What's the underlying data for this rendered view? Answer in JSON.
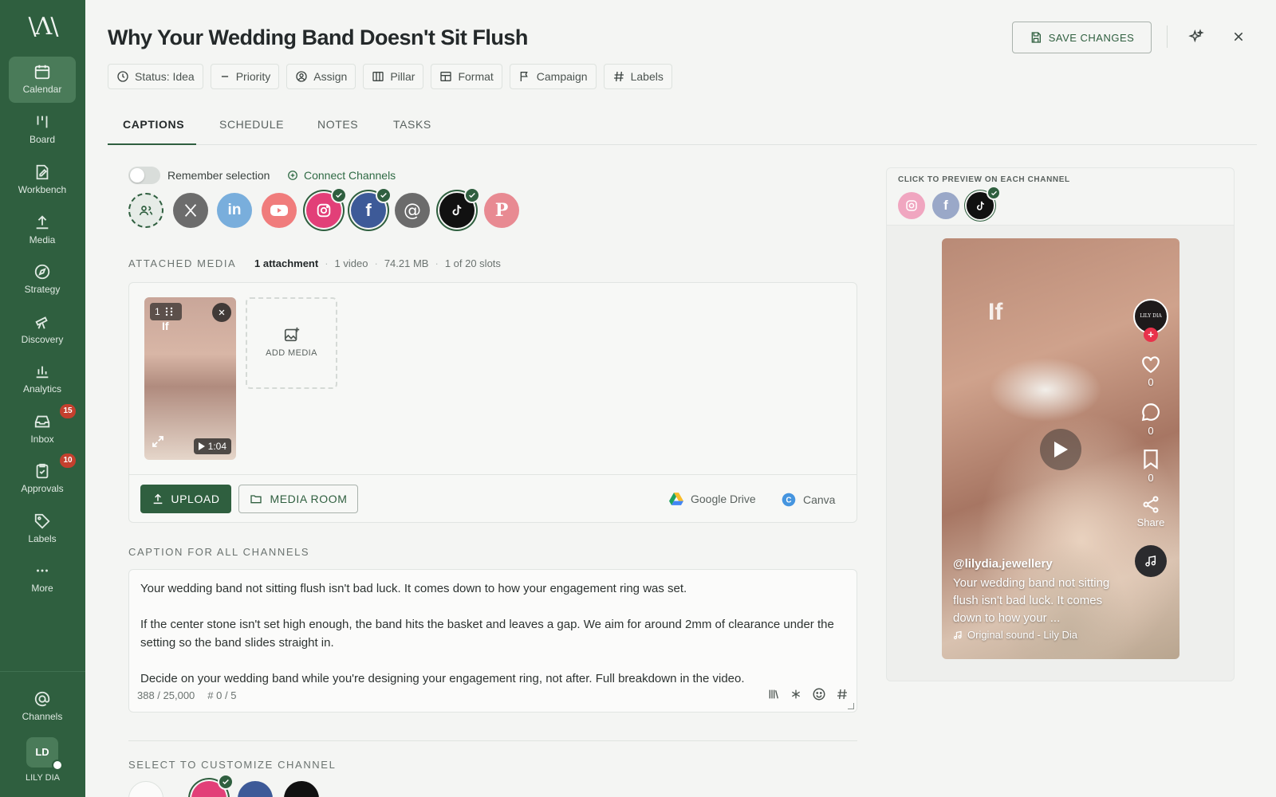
{
  "sidebar": {
    "logo": "\\Λ\\",
    "items": [
      {
        "label": "Calendar",
        "icon": "calendar-icon",
        "active": true
      },
      {
        "label": "Board",
        "icon": "board-icon"
      },
      {
        "label": "Workbench",
        "icon": "workbench-icon"
      },
      {
        "label": "Media",
        "icon": "upload-icon"
      },
      {
        "label": "Strategy",
        "icon": "compass-icon"
      },
      {
        "label": "Discovery",
        "icon": "telescope-icon"
      },
      {
        "label": "Analytics",
        "icon": "bar-chart-icon"
      },
      {
        "label": "Inbox",
        "icon": "inbox-icon",
        "badge": "15"
      },
      {
        "label": "Approvals",
        "icon": "clipboard-check-icon",
        "badge": "10"
      },
      {
        "label": "Labels",
        "icon": "tag-icon"
      },
      {
        "label": "More",
        "icon": "more-dots-icon"
      }
    ],
    "channels_label": "Channels",
    "user_initials": "LD",
    "user_name": "LILY DIA"
  },
  "header": {
    "title": "Why Your Wedding Band Doesn't Sit Flush",
    "save_label": "SAVE CHANGES",
    "chips": [
      {
        "label": "Status: Idea",
        "icon": "status-circle-icon"
      },
      {
        "label": "Priority",
        "icon": "minus-icon"
      },
      {
        "label": "Assign",
        "icon": "user-circle-icon"
      },
      {
        "label": "Pillar",
        "icon": "columns-icon"
      },
      {
        "label": "Format",
        "icon": "layout-icon"
      },
      {
        "label": "Campaign",
        "icon": "flag-icon"
      },
      {
        "label": "Labels",
        "icon": "hash-icon"
      }
    ]
  },
  "tabs": [
    {
      "label": "CAPTIONS",
      "active": true
    },
    {
      "label": "SCHEDULE"
    },
    {
      "label": "NOTES"
    },
    {
      "label": "TASKS"
    }
  ],
  "channels": {
    "remember_label": "Remember selection",
    "connect_label": "Connect Channels",
    "list": [
      {
        "name": "groups",
        "color": "#e6ece7",
        "selected": false
      },
      {
        "name": "x",
        "color": "#6c6c6c",
        "selected": false
      },
      {
        "name": "linkedin",
        "color": "#79aedc",
        "selected": false
      },
      {
        "name": "youtube",
        "color": "#f07c7c",
        "selected": false
      },
      {
        "name": "instagram",
        "color": "#e23f78",
        "selected": true
      },
      {
        "name": "facebook",
        "color": "#3d5a98",
        "selected": true
      },
      {
        "name": "threads",
        "color": "#6b6b6b",
        "selected": false
      },
      {
        "name": "tiktok",
        "color": "#111111",
        "selected": true
      },
      {
        "name": "pinterest",
        "color": "#e88a92",
        "selected": false
      }
    ]
  },
  "media": {
    "section_label": "ATTACHED MEDIA",
    "attachments": "1 attachment",
    "videos": "1 video",
    "size": "74.21 MB",
    "slots": "1 of 20 slots",
    "thumb_index": "1",
    "thumb_overlay_text": "If",
    "duration": "1:04",
    "add_label": "ADD MEDIA",
    "upload_label": "UPLOAD",
    "media_room_label": "MEDIA ROOM",
    "google_drive_label": "Google Drive",
    "canva_label": "Canva"
  },
  "caption": {
    "section_label": "CAPTION FOR ALL CHANNELS",
    "text": "Your wedding band not sitting flush isn't bad luck. It comes down to how your engagement ring was set.\n\nIf the center stone isn't set high enough, the band hits the basket and leaves a gap. We aim for around 2mm of clearance under the setting so the band slides straight in.\n\nDecide on your wedding band while you're designing your engagement ring, not after. Full breakdown in the video.",
    "char_count": "388 / 25,000",
    "hashtag_count": "# 0 / 5"
  },
  "customize": {
    "section_label": "SELECT TO CUSTOMIZE CHANNEL"
  },
  "preview": {
    "label": "CLICK TO PREVIEW ON EACH CHANNEL",
    "overlay_text": "If",
    "avatar_text": "LILY DIA",
    "likes": "0",
    "comments": "0",
    "saves": "0",
    "share_label": "Share",
    "handle": "@lilydia.jewellery",
    "caption": "Your wedding band not sitting flush isn't bad luck. It comes down to how your ...",
    "sound": "Original sound - Lily Dia"
  },
  "colors": {
    "brand_green": "#2f5f3f",
    "badge_red": "#c4402e"
  }
}
